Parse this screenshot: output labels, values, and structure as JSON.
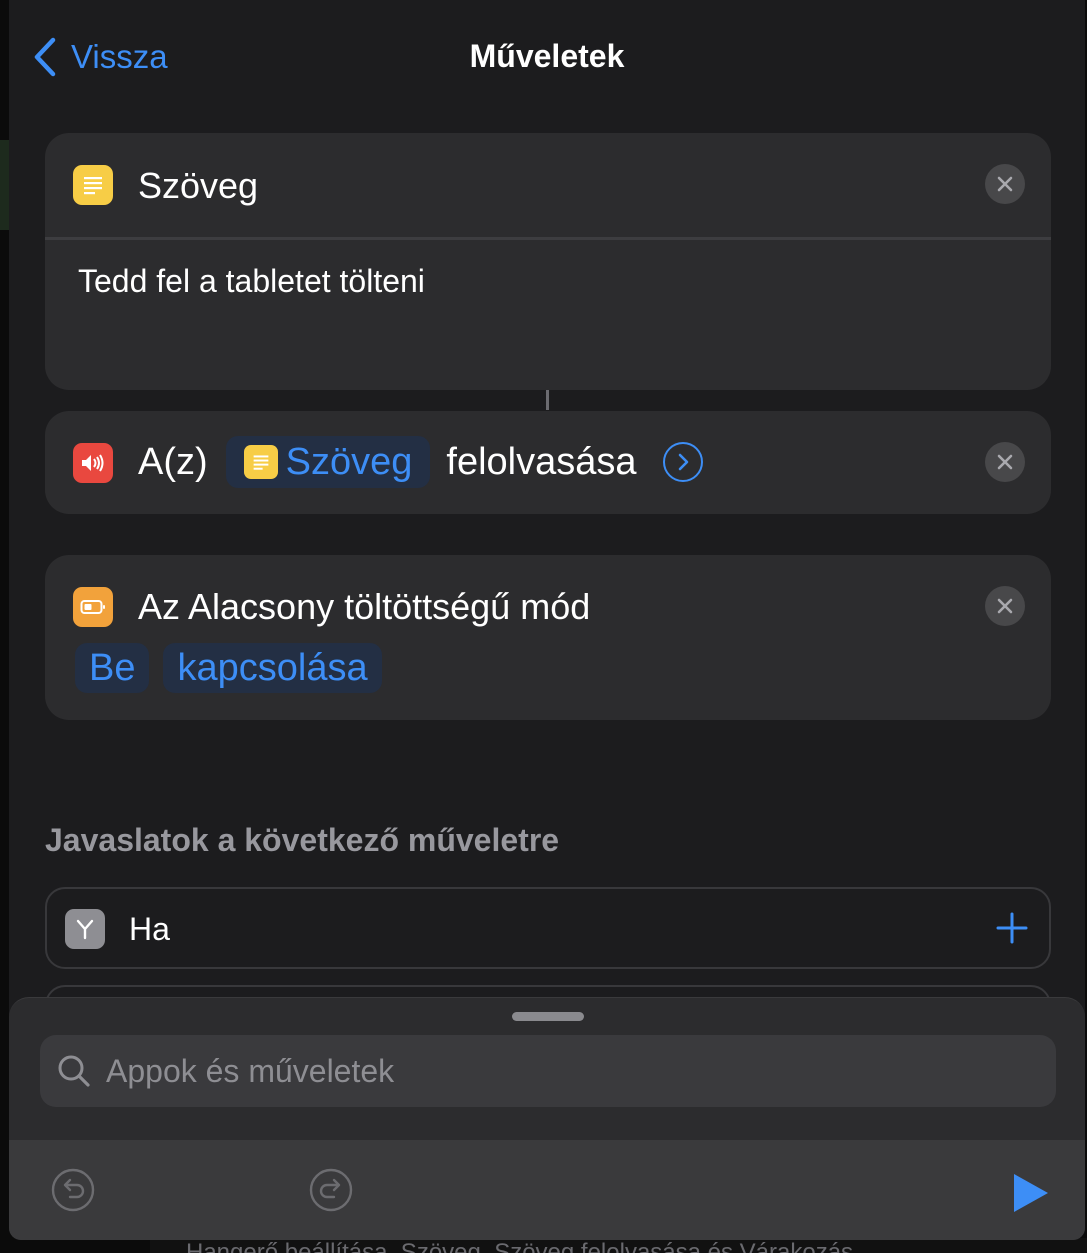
{
  "nav": {
    "back_label": "Vissza",
    "title": "Műveletek"
  },
  "actions": [
    {
      "title": "Szöveg",
      "body": "Tedd fel a tabletet tölteni",
      "icon": "text-document-icon",
      "icon_color": "#f7cd46"
    },
    {
      "prefix": "A(z)",
      "token": "Szöveg",
      "suffix": "felolvasása",
      "icon": "speaker-icon",
      "icon_color": "#e9483f"
    },
    {
      "title": "Az Alacsony töltöttségű mód",
      "token_state": "Be",
      "token_action": "kapcsolása",
      "icon": "battery-icon",
      "icon_color": "#f2a23b"
    }
  ],
  "suggestions": {
    "header": "Javaslatok a következő műveletre",
    "items": [
      {
        "label": "Ha",
        "icon": "branch-icon"
      }
    ]
  },
  "search": {
    "placeholder": "Appok és műveletek"
  },
  "background_text": "Hangerő beállítása, Szöveg, Szöveg felolvasása és Várakozás",
  "colors": {
    "accent": "#3d8ef6",
    "sheet_bg": "#1c1c1e",
    "card_bg": "#2c2c2e"
  }
}
